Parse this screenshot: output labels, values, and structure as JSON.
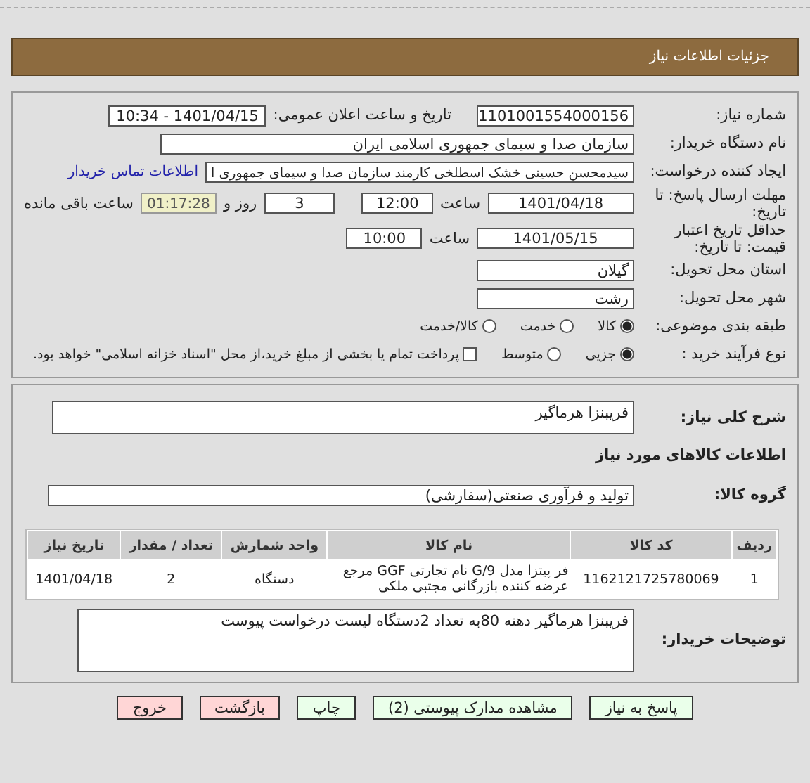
{
  "header": {
    "title": "جزئیات اطلاعات نیاز"
  },
  "details": {
    "need_number": {
      "label": "شماره نیاز:",
      "value": "1101001554000156"
    },
    "announce": {
      "label": "تاریخ و ساعت اعلان عمومی:",
      "value": "1401/04/15 - 10:34"
    },
    "buyer": {
      "label": "نام دستگاه خریدار:",
      "value": "سازمان صدا و سیمای جمهوری اسلامی ایران"
    },
    "creator": {
      "label": "ایجاد کننده درخواست:",
      "value": "سیدمحسن حسینی خشک اسطلخی کارمند سازمان صدا و سیمای جمهوری ا",
      "link": "اطلاعات تماس خریدار"
    },
    "deadline": {
      "label": "مهلت ارسال پاسخ: تا تاریخ:",
      "date": "1401/04/18",
      "time_label": "ساعت",
      "time": "12:00",
      "days": "3",
      "days_label": "روز و",
      "remaining": "01:17:28",
      "remaining_label": "ساعت باقی مانده"
    },
    "validity": {
      "label": "حداقل تاریخ اعتبار قیمت: تا تاریخ:",
      "date": "1401/05/15",
      "time_label": "ساعت",
      "time": "10:00"
    },
    "province": {
      "label": "استان محل تحویل:",
      "value": "گیلان"
    },
    "city": {
      "label": "شهر محل تحویل:",
      "value": "رشت"
    },
    "category": {
      "label": "طبقه بندی موضوعی:",
      "options": [
        {
          "label": "کالا",
          "selected": true
        },
        {
          "label": "خدمت",
          "selected": false
        },
        {
          "label": "کالا/خدمت",
          "selected": false
        }
      ]
    },
    "process": {
      "label": "نوع فرآیند خرید :",
      "options": [
        {
          "label": "جزیی",
          "selected": true
        },
        {
          "label": "متوسط",
          "selected": false
        }
      ],
      "treasury": {
        "label": "پرداخت تمام یا بخشی از مبلغ خرید،از محل \"اسناد خزانه اسلامی\" خواهد بود.",
        "checked": false
      }
    }
  },
  "needs": {
    "summary": {
      "label": "شرح کلی نیاز:",
      "value": "فریبنزا هرماگیر"
    },
    "goods_title": "اطلاعات کالاهای مورد نیاز",
    "group": {
      "label": "گروه کالا:",
      "value": "تولید و فرآوری صنعتی(سفارشی)"
    },
    "table": {
      "columns": [
        "ردیف",
        "کد کالا",
        "نام کالا",
        "واحد شمارش",
        "تعداد / مقدار",
        "تاریخ نیاز"
      ],
      "rows": [
        [
          "1",
          "1162121725780069",
          "فر پیتزا مدل G/9 نام تجارتی GGF مرجع عرضه کننده بازرگانی مجتبی ملکی",
          "دستگاه",
          "2",
          "1401/04/18"
        ]
      ]
    },
    "notes": {
      "label": "توضیحات خریدار:",
      "value": "فریبنزا هرماگیر دهنه 80به تعداد 2دستگاه لیست درخواست پیوست"
    }
  },
  "buttons": [
    {
      "label": "پاسخ به نیاز",
      "kind": "go"
    },
    {
      "label": "مشاهده مدارک پیوستی (2)",
      "kind": "go"
    },
    {
      "label": "چاپ",
      "kind": "go"
    },
    {
      "label": "بازگشت",
      "kind": "stop"
    },
    {
      "label": "خروج",
      "kind": "stop"
    }
  ]
}
